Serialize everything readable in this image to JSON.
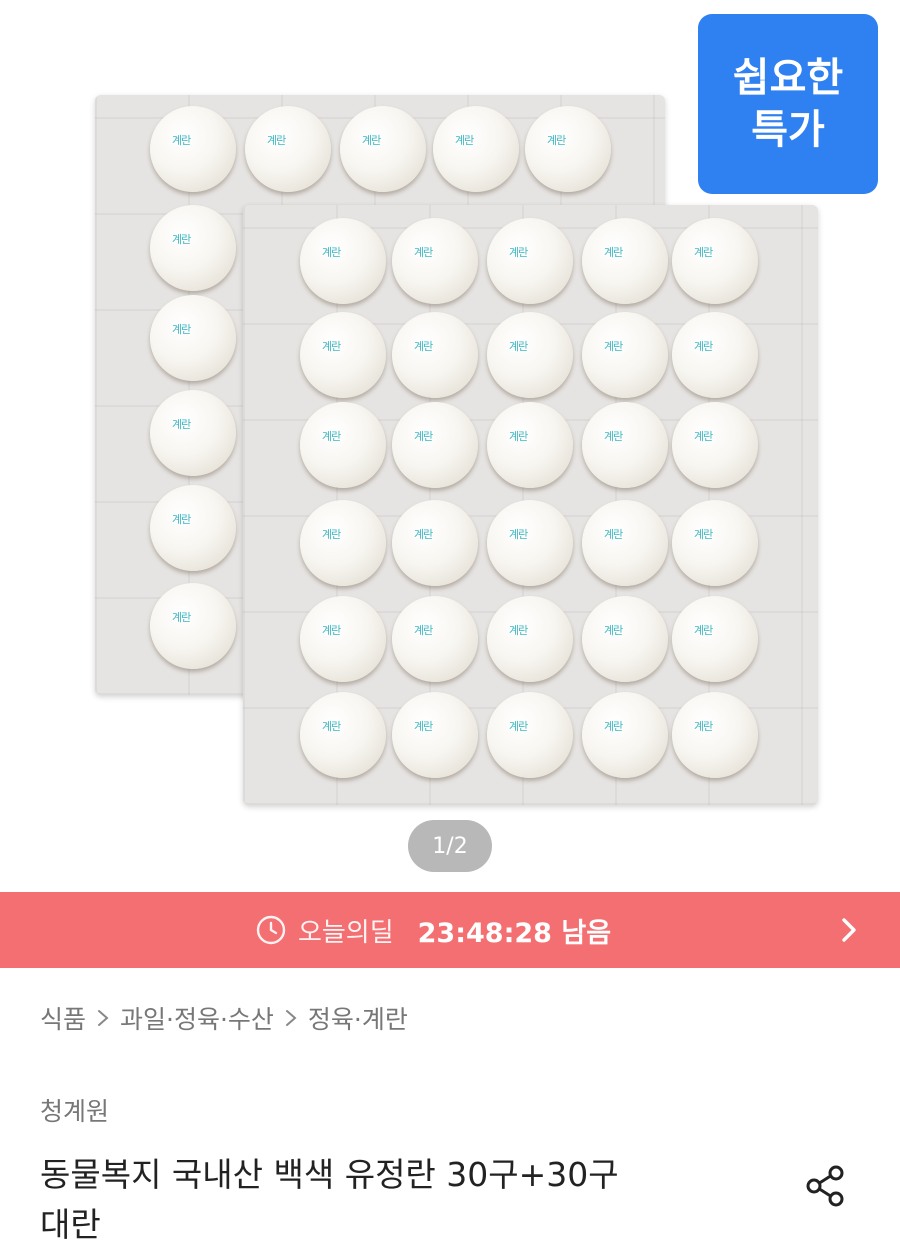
{
  "hero": {
    "badge_line1": "쉽요한",
    "badge_line2": "특가",
    "pager": "1/2"
  },
  "deal": {
    "icon": "clock-icon",
    "label": "오늘의딜",
    "remaining": "23:48:28 남음",
    "chevron": "chevron-right-icon"
  },
  "breadcrumb": {
    "items": [
      "식품",
      "과일·정육·수산",
      "정육·계란"
    ]
  },
  "product": {
    "brand": "청계원",
    "title_line1": "동물복지 국내산 백색 유정란 30구+30구",
    "title_line2": "대란",
    "share_icon": "share-icon"
  },
  "colors": {
    "badge": "#2f80f0",
    "deal_bar": "#f46f72",
    "egg_stamp": "#3db8c4"
  }
}
